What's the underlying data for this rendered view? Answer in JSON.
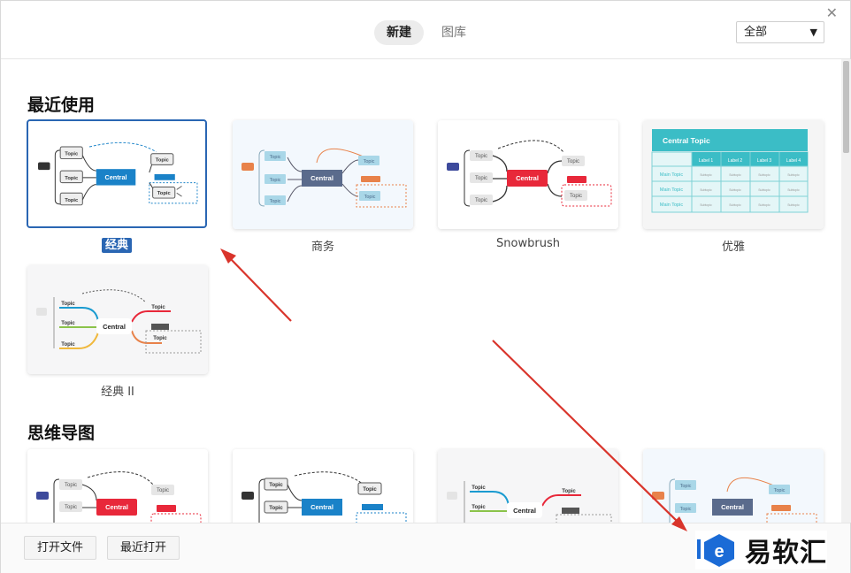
{
  "tabs": [
    {
      "label": "新建",
      "active": true
    },
    {
      "label": "图库",
      "active": false
    }
  ],
  "filter": {
    "value": "全部"
  },
  "sections": [
    {
      "title": "最近使用"
    },
    {
      "title": "思维导图"
    }
  ],
  "recent_templates": [
    {
      "label": "经典",
      "selected": true
    },
    {
      "label": "商务",
      "selected": false
    },
    {
      "label": "Snowbrush",
      "selected": false
    },
    {
      "label": "优雅",
      "selected": false
    },
    {
      "label": "经典 II",
      "selected": false
    }
  ],
  "thumb_text": {
    "topic": "Topic",
    "central": "Central",
    "central_topic": "Central Topic",
    "main_topic": "Main Topic",
    "subtopic": "Subtopic",
    "labels": [
      "Label 1",
      "Label 2",
      "Label 3",
      "Label 4"
    ]
  },
  "bottom": {
    "open_file": "打开文件",
    "recent_open": "最近打开"
  },
  "watermark": {
    "text": "易软汇"
  },
  "colors": {
    "selected": "#2a66b3",
    "arrow": "#d9342b",
    "classic": "#1a82c8",
    "business": "#5a6b8c",
    "snowbrush": "#e8283a",
    "elegant": "#3bbdc6"
  }
}
